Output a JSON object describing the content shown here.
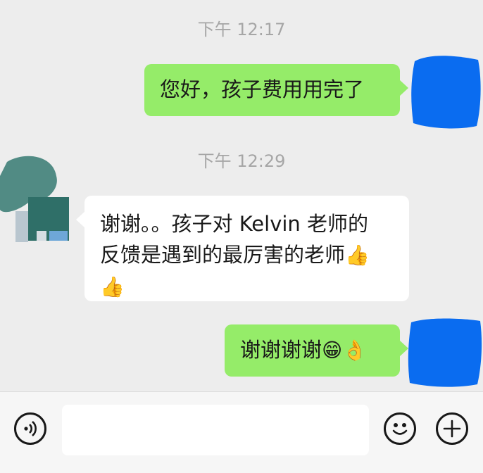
{
  "chat": {
    "messages": [
      {
        "type": "timestamp",
        "text": "下午 12:17"
      },
      {
        "type": "outgoing",
        "text": "您好，孩子费用用完了"
      },
      {
        "type": "timestamp",
        "text": "下午 12:29"
      },
      {
        "type": "incoming",
        "lines": [
          "谢谢。。孩子对 Kelvin 老师的",
          "反馈是遇到的最厉害的老师"
        ],
        "trailing_emoji": "thumbs-up"
      },
      {
        "type": "outgoing",
        "text": "谢谢谢谢",
        "trailing_emoji": [
          "grinning-face",
          "ok-hand"
        ]
      }
    ]
  },
  "input_bar": {
    "voice_icon": "voice-icon",
    "emoji_icon": "smiley-icon",
    "add_icon": "plus-icon",
    "input_value": ""
  },
  "colors": {
    "background": "#ededed",
    "outgoing_bubble": "#95ec69",
    "incoming_bubble": "#ffffff",
    "timestamp": "#a6a6a6",
    "avatar_redaction": "#0a6cf0"
  }
}
